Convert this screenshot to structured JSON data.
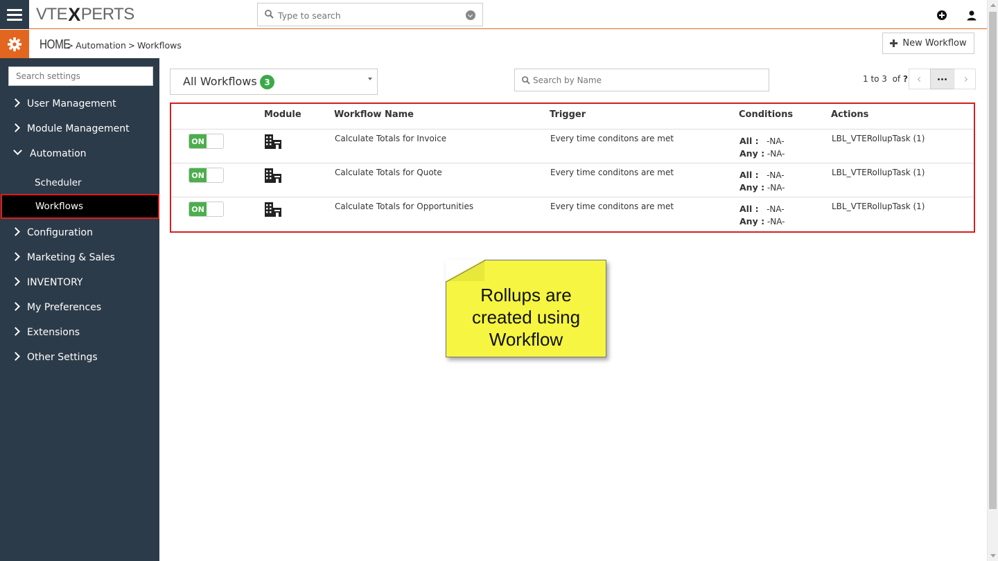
{
  "topbar": {
    "logo_pre": "VTE",
    "logo_x": "X",
    "logo_post": "PERTS",
    "search_placeholder": "Type to search"
  },
  "breadcrumb": {
    "home": "HOME",
    "items": [
      "Automation",
      "Workflows"
    ]
  },
  "new_workflow_label": "New Workflow",
  "sidebar": {
    "search_placeholder": "Search settings",
    "items": [
      {
        "label": "User Management"
      },
      {
        "label": "Module Management"
      },
      {
        "label": "Automation",
        "sub": [
          "Scheduler",
          "Workflows"
        ]
      },
      {
        "label": "Configuration"
      },
      {
        "label": "Marketing & Sales"
      },
      {
        "label": "INVENTORY"
      },
      {
        "label": "My Preferences"
      },
      {
        "label": "Extensions"
      },
      {
        "label": "Other Settings"
      }
    ]
  },
  "filter": {
    "label": "All Workflows",
    "count": "3"
  },
  "name_search_placeholder": "Search by Name",
  "pager": {
    "range": "1 to 3",
    "of": "of",
    "total": "?"
  },
  "table": {
    "headers": [
      "Module",
      "Workflow Name",
      "Trigger",
      "Conditions",
      "Actions"
    ],
    "rows": [
      {
        "status": "ON",
        "name": "Calculate Totals for Invoice",
        "trigger": "Every time conditons are met",
        "all_label": "All :",
        "all": "-NA-",
        "any_label": "Any :",
        "any": "-NA-",
        "action": "LBL_VTERollupTask (1)"
      },
      {
        "status": "ON",
        "name": "Calculate Totals for Quote",
        "trigger": "Every time conditons are met",
        "all_label": "All :",
        "all": "-NA-",
        "any_label": "Any :",
        "any": "-NA-",
        "action": "LBL_VTERollupTask (1)"
      },
      {
        "status": "ON",
        "name": "Calculate Totals for Opportunities",
        "trigger": "Every time conditons are met",
        "all_label": "All :",
        "all": "-NA-",
        "any_label": "Any :",
        "any": "-NA-",
        "action": "LBL_VTERollupTask (1)"
      }
    ]
  },
  "note": {
    "lines": [
      "Rollups are",
      "created using",
      "Workflow"
    ]
  },
  "colors": {
    "accent": "#e2661f",
    "sidebar": "#2c3b49",
    "highlight": "#d21e1e",
    "toggle_on": "#4cae4c",
    "badge": "#3aa948",
    "note": "#f5f542"
  }
}
